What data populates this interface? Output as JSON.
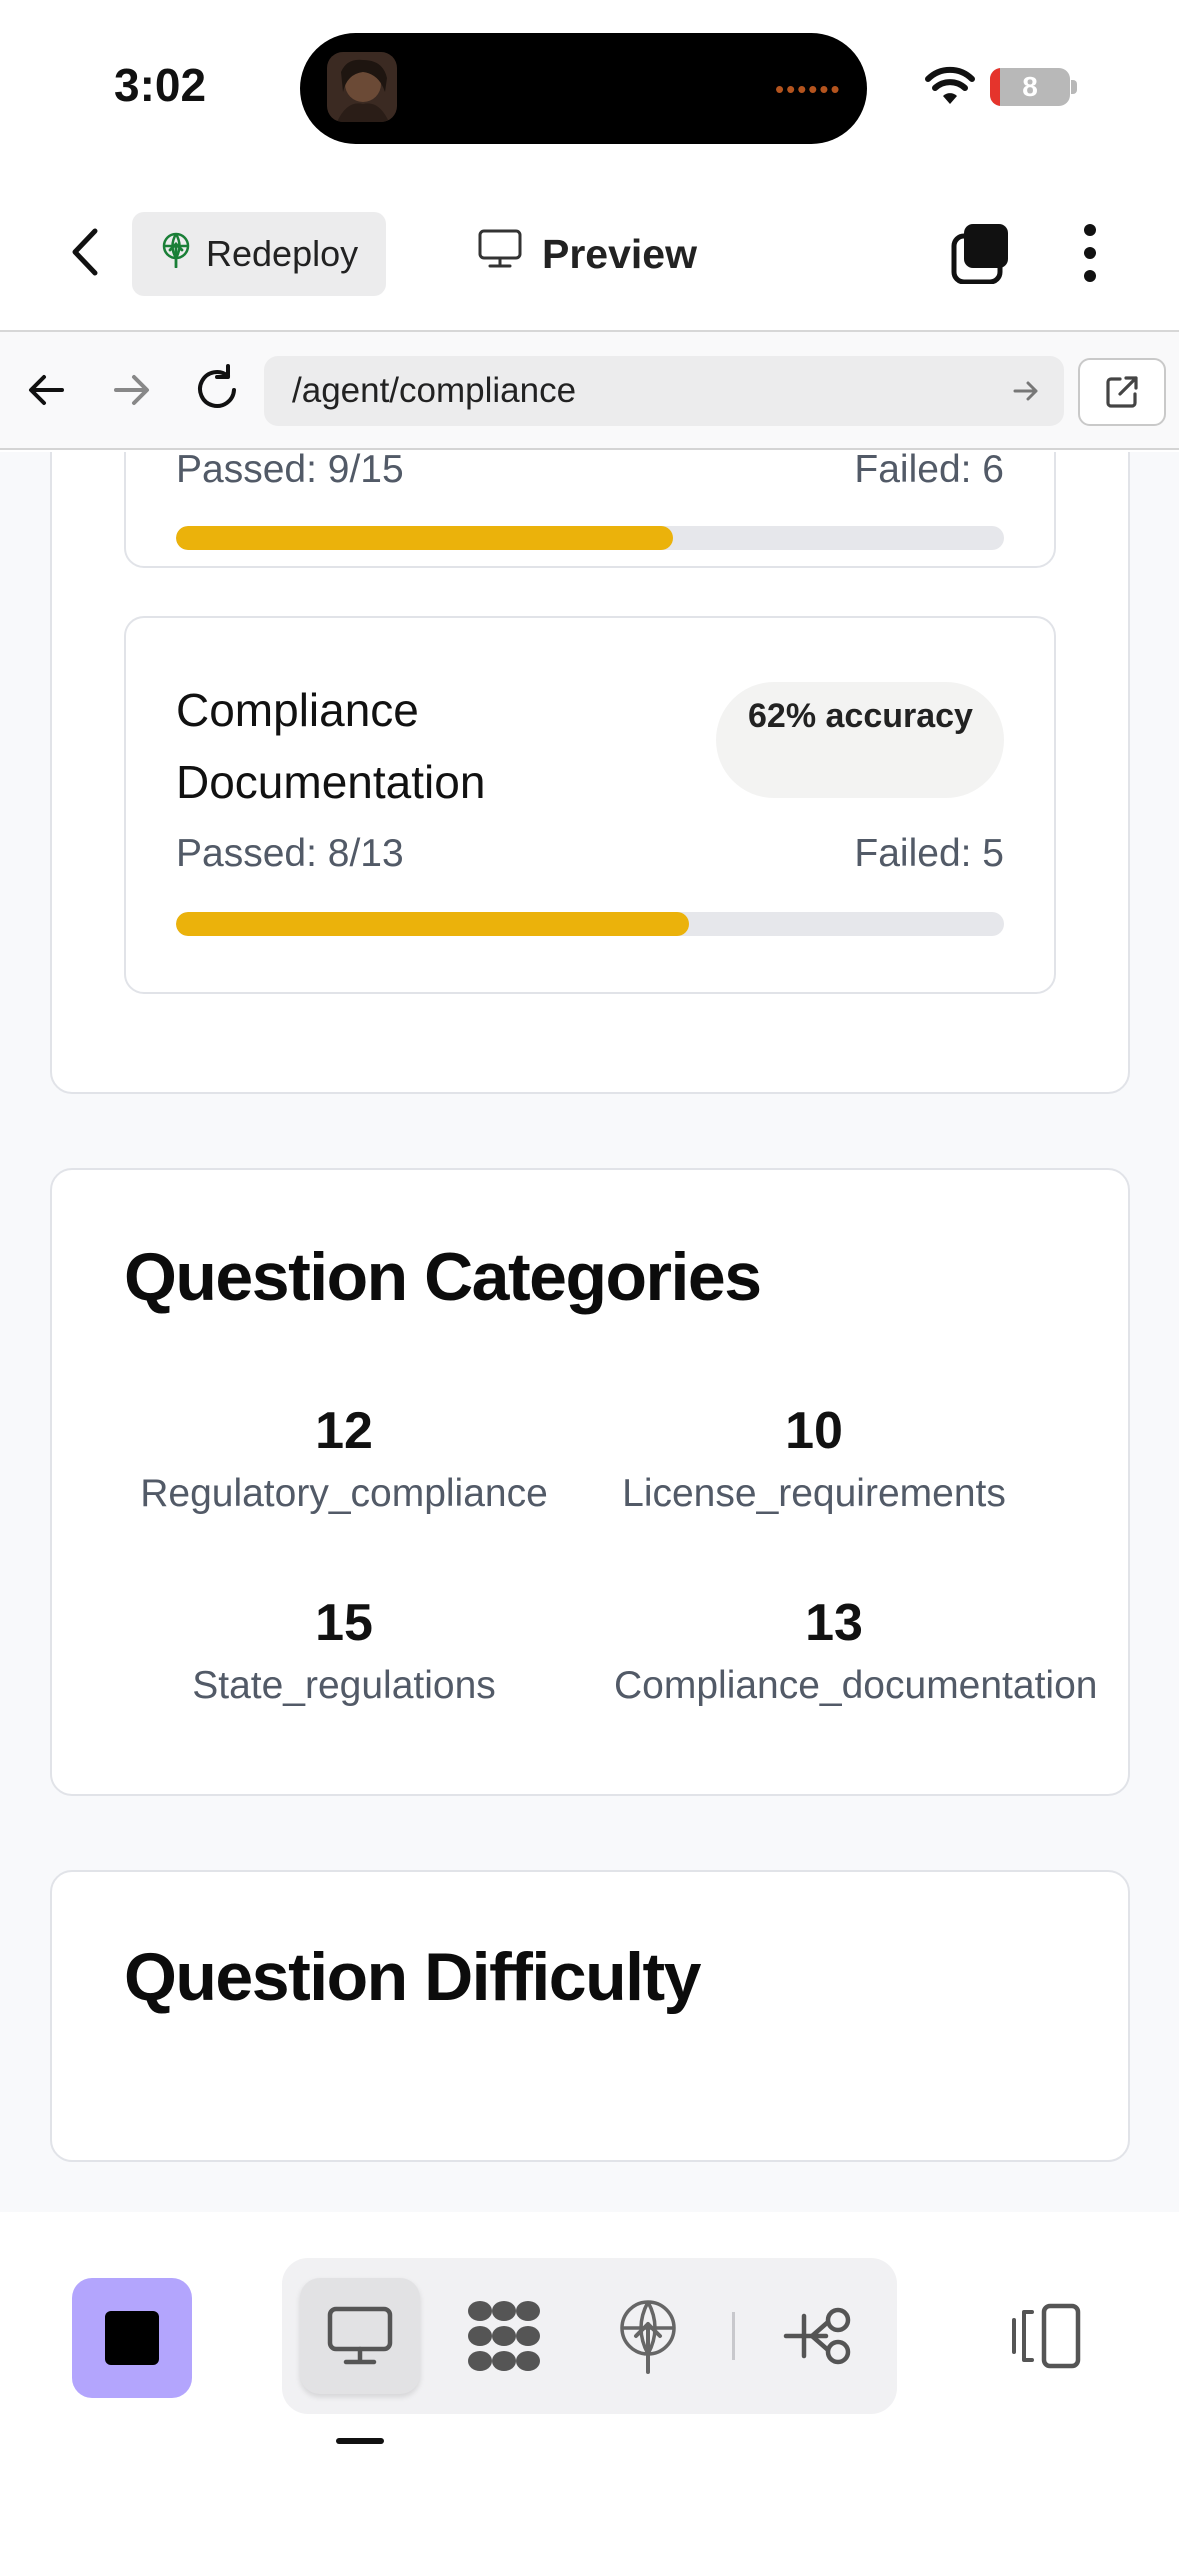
{
  "status_bar": {
    "time": "3:02",
    "battery": "8",
    "island_indicator": "••••••"
  },
  "toolbar": {
    "back_icon": "chevron-left-icon",
    "redeploy_label": "Redeploy",
    "preview_label": "Preview",
    "tabs_icon": "tabs-icon",
    "more_icon": "more-vertical-icon"
  },
  "url_bar": {
    "url": "/agent/compliance"
  },
  "results_card": {
    "prev_item": {
      "passed": "Passed: 9/15",
      "failed": "Failed: 6",
      "progress": 0.6
    },
    "item": {
      "title": "Compliance Documentation",
      "accuracy": "62% accuracy",
      "passed": "Passed: 8/13",
      "failed": "Failed: 5",
      "progress": 0.62
    }
  },
  "categories_card": {
    "title": "Question Categories",
    "items": [
      {
        "count": "12",
        "name": "Regulatory_compliance"
      },
      {
        "count": "10",
        "name": "License_requirements"
      },
      {
        "count": "15",
        "name": "State_regulations"
      },
      {
        "count": "13",
        "name": "Compliance_documentation"
      }
    ]
  },
  "difficulty_card": {
    "title": "Question Difficulty"
  },
  "bottom_bar": {
    "stop_icon": "stop-icon",
    "modes": [
      "monitor-icon",
      "shapes-icon",
      "deploy-icon",
      "flow-icon"
    ],
    "active_mode": "monitor-icon",
    "panel_icon": "panel-toggle-icon",
    "accent": "#b3a5fd"
  },
  "colors": {
    "progress": "#ebb20b",
    "track": "#e6e7eb",
    "muted_text": "#525a67"
  }
}
